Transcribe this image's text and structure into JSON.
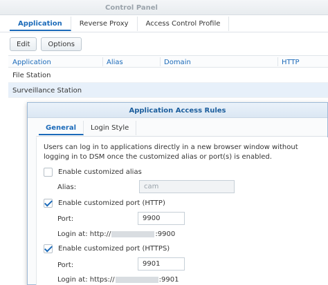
{
  "window": {
    "title": "Control Panel"
  },
  "tabs": [
    {
      "label": "Application"
    },
    {
      "label": "Reverse Proxy"
    },
    {
      "label": "Access Control Profile"
    }
  ],
  "toolbar": {
    "edit_label": "Edit",
    "options_label": "Options"
  },
  "table": {
    "columns": [
      "Application",
      "Alias",
      "Domain",
      "HTTP"
    ],
    "rows": [
      {
        "application": "File Station"
      },
      {
        "application": "Surveillance Station"
      }
    ]
  },
  "dialog": {
    "title": "Application Access Rules",
    "tabs": [
      {
        "label": "General"
      },
      {
        "label": "Login Style"
      }
    ],
    "description": "Users can log in to applications directly in a new browser window without logging in to DSM once the customized alias or port(s) is enabled.",
    "alias_checkbox": {
      "label": "Enable customized alias",
      "checked": false
    },
    "alias_field": {
      "label": "Alias:",
      "value": "cam"
    },
    "http_checkbox": {
      "label": "Enable customized port (HTTP)",
      "checked": true
    },
    "http_port": {
      "label": "Port:",
      "value": "9900"
    },
    "http_login": {
      "prefix": "Login at: http://",
      "suffix": ":9900"
    },
    "https_checkbox": {
      "label": "Enable customized port (HTTPS)",
      "checked": true
    },
    "https_port": {
      "label": "Port:",
      "value": "9901"
    },
    "https_login": {
      "prefix": "Login at: https://",
      "suffix": ":9901"
    }
  }
}
